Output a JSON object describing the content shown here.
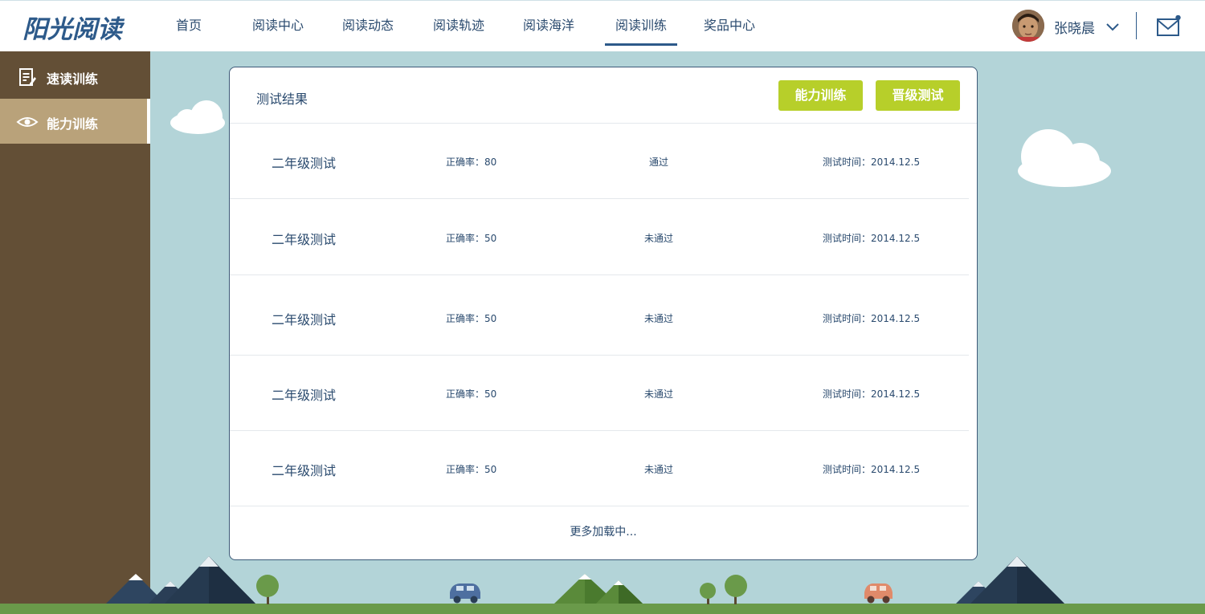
{
  "app": {
    "logo_text": "阳光阅读"
  },
  "nav": {
    "items": [
      {
        "label": "首页",
        "active": false
      },
      {
        "label": "阅读中心",
        "active": false
      },
      {
        "label": "阅读动态",
        "active": false
      },
      {
        "label": "阅读轨迹",
        "active": false
      },
      {
        "label": "阅读海洋",
        "active": false
      },
      {
        "label": "阅读训练",
        "active": true
      },
      {
        "label": "奖品中心",
        "active": false
      }
    ]
  },
  "user": {
    "name": "张晓晨"
  },
  "sidebar": {
    "items": [
      {
        "label": "速读训练",
        "icon": "document-edit-icon",
        "active": false
      },
      {
        "label": "能力训练",
        "icon": "eye-icon",
        "active": true
      }
    ]
  },
  "results": {
    "title": "测试结果",
    "buttons": {
      "ability_training": "能力训练",
      "promotion_test": "晋级测试"
    },
    "rows": [
      {
        "name": "二年级测试",
        "score": "正确率：80",
        "status": "通过",
        "time": "测试时间：2014.12.5"
      },
      {
        "name": "二年级测试",
        "score": "正确率：50",
        "status": "未通过",
        "time": "测试时间：2014.12.5"
      },
      {
        "name": "二年级测试",
        "score": "正确率：50",
        "status": "未通过",
        "time": "测试时间：2014.12.5"
      },
      {
        "name": "二年级测试",
        "score": "正确率：50",
        "status": "未通过",
        "time": "测试时间：2014.12.5"
      },
      {
        "name": "二年级测试",
        "score": "正确率：50",
        "status": "未通过",
        "time": "测试时间：2014.12.5"
      }
    ],
    "load_more": "更多加载中..."
  },
  "colors": {
    "brand": "#2d5a8a",
    "accent_button": "#b7cf2a",
    "sidebar_bg": "#634f36",
    "sidebar_active": "#b9a27a",
    "background_sky": "#b3d4d8",
    "ground": "#6a9a4a"
  }
}
